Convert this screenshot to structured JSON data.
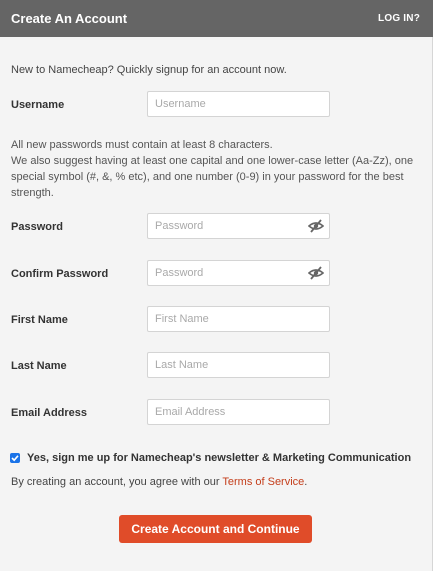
{
  "header": {
    "title": "Create An Account",
    "login_label": "LOG IN?"
  },
  "intro": "New to Namecheap? Quickly signup for an account now.",
  "password_note": {
    "line1": "All new passwords must contain at least 8 characters.",
    "line2": "We also suggest having at least one capital and one lower-case letter (Aa-Zz), one special symbol (#, &, % etc), and one number (0-9) in your password for the best strength."
  },
  "fields": {
    "username": {
      "label": "Username",
      "placeholder": "Username",
      "value": ""
    },
    "password": {
      "label": "Password",
      "placeholder": "Password",
      "value": ""
    },
    "confirm_password": {
      "label": "Confirm Password",
      "placeholder": "Password",
      "value": ""
    },
    "first_name": {
      "label": "First Name",
      "placeholder": "First Name",
      "value": ""
    },
    "last_name": {
      "label": "Last Name",
      "placeholder": "Last Name",
      "value": ""
    },
    "email": {
      "label": "Email Address",
      "placeholder": "Email Address",
      "value": ""
    }
  },
  "newsletter": {
    "checked": true,
    "label": "Yes, sign me up for Namecheap's newsletter & Marketing Communication"
  },
  "agreement": {
    "text": "By creating an account, you agree with our ",
    "link": "Terms of Service",
    "suffix": "."
  },
  "submit_label": "Create Account and Continue",
  "icons": {
    "password_toggle": "eye-slash-icon",
    "checkbox": "checkmark-icon"
  },
  "colors": {
    "header_bg": "#656565",
    "panel_bg": "#f4f4f4",
    "accent": "#e04c29",
    "link": "#c43d1a",
    "checkbox": "#1a73e8"
  }
}
